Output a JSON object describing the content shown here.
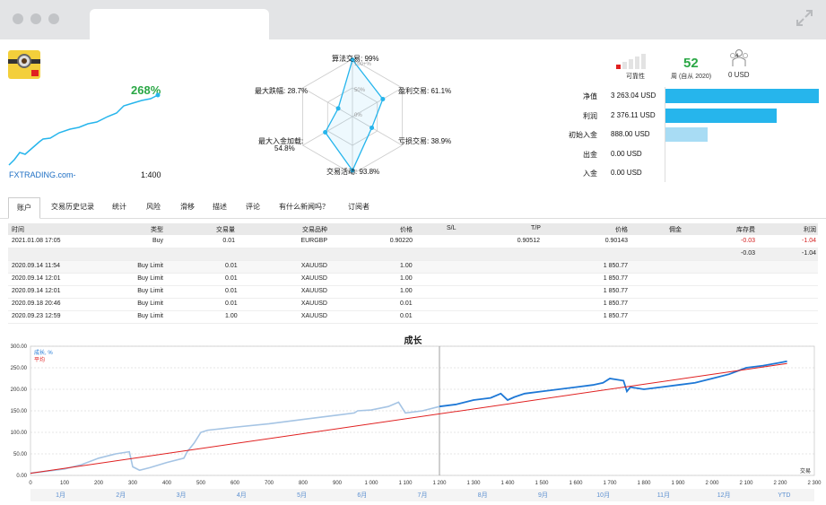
{
  "header": {
    "growth": "268%",
    "broker": "FXTRADING.com-",
    "leverage": "1:400"
  },
  "radar": {
    "algo": "算法交易: 99%",
    "scale100": "100+%",
    "scale50": "50%",
    "scale0": "0%",
    "profit_trades": "盈利交易: 61.1%",
    "loss_trades": "亏损交易: 38.9%",
    "activity": "交易活动: 93.8%",
    "max_deposit_load1": "最大入金加载:",
    "max_deposit_load2": "54.8%",
    "max_drawdown": "最大跌幅: 28.7%",
    "values": [
      99,
      61.1,
      38.9,
      93.8,
      54.8,
      28.7
    ]
  },
  "stats": {
    "reliability_label": "可靠性",
    "weeks_value": "52",
    "weeks_label": "周 (自从 2020)",
    "subscribers_value": "0 USD",
    "subscribers_count": "4"
  },
  "finance": [
    {
      "label": "净值",
      "value": "3 263.04 USD",
      "fraction": 1.0,
      "color": "#26b5ec"
    },
    {
      "label": "利润",
      "value": "2 376.11 USD",
      "fraction": 0.728,
      "color": "#26b5ec"
    },
    {
      "label": "初始入金",
      "value": "888.00 USD",
      "fraction": 0.272,
      "color": "#a8dcf4"
    },
    {
      "label": "出金",
      "value": "0.00 USD",
      "fraction": 0,
      "color": "#26b5ec"
    },
    {
      "label": "入金",
      "value": "0.00 USD",
      "fraction": 0,
      "color": "#26b5ec"
    }
  ],
  "tabs": [
    "账户",
    "交易历史记录",
    "统计",
    "风险",
    "滑移",
    "描述",
    "评论",
    "有什么新闻吗？",
    "订阅者"
  ],
  "table": {
    "headers": [
      "时间",
      "类型",
      "交易量",
      "交易品种",
      "价格",
      "S/L",
      "T/P",
      "价格",
      "佣金",
      "库存费",
      "利润"
    ],
    "open_row": [
      "2021.01.08 17:05",
      "Buy",
      "0.01",
      "EURGBP",
      "0.90220",
      "",
      "0.90512",
      "0.90143",
      "",
      "-0.03",
      "-1.04"
    ],
    "total_row": {
      "swap": "-0.03",
      "profit": "-1.04"
    },
    "orders": [
      [
        "2020.09.14 11:54",
        "Buy Limit",
        "0.01",
        "XAUUSD",
        "1.00",
        "1 850.77"
      ],
      [
        "2020.09.14 12:01",
        "Buy Limit",
        "0.01",
        "XAUUSD",
        "1.00",
        "1 850.77"
      ],
      [
        "2020.09.14 12:01",
        "Buy Limit",
        "0.01",
        "XAUUSD",
        "1.00",
        "1 850.77"
      ],
      [
        "2020.09.18 20:46",
        "Buy Limit",
        "0.01",
        "XAUUSD",
        "0.01",
        "1 850.77"
      ],
      [
        "2020.09.23 12:59",
        "Buy Limit",
        "1.00",
        "XAUUSD",
        "0.01",
        "1 850.77"
      ]
    ]
  },
  "chart_data": {
    "type": "line",
    "title": "成长",
    "legend": [
      "成长, %",
      "平均"
    ],
    "xlabel": "交易",
    "xlim": [
      0,
      2300
    ],
    "ylim": [
      0,
      300
    ],
    "yticks": [
      "0.00",
      "50.00",
      "100.00",
      "150.00",
      "200.00",
      "250.00",
      "300.00"
    ],
    "xticks": [
      "0",
      "100",
      "200",
      "300",
      "400",
      "500",
      "600",
      "700",
      "800",
      "900",
      "1 000",
      "1 100",
      "1 200",
      "1 300",
      "1 400",
      "1 500",
      "1 600",
      "1 700",
      "1 800",
      "1 900",
      "2 000",
      "2 100",
      "2 200",
      "2 300"
    ],
    "months": [
      "1月",
      "2月",
      "3月",
      "4月",
      "5月",
      "6月",
      "7月",
      "8月",
      "9月",
      "10月",
      "11月",
      "12月",
      "YTD"
    ],
    "series": [
      {
        "name": "成长, %",
        "x": [
          0,
          50,
          100,
          150,
          200,
          250,
          290,
          300,
          320,
          350,
          400,
          450,
          460,
          480,
          500,
          520,
          600,
          700,
          800,
          900,
          950,
          960,
          1000,
          1050,
          1080,
          1100,
          1150,
          1200,
          1250,
          1300,
          1350,
          1380,
          1400,
          1420,
          1450,
          1500,
          1550,
          1600,
          1650,
          1680,
          1700,
          1740,
          1750,
          1760,
          1800,
          1850,
          1900,
          1950,
          2000,
          2050,
          2100,
          2150,
          2200,
          2220
        ],
        "y": [
          5,
          10,
          15,
          25,
          40,
          50,
          55,
          20,
          12,
          18,
          30,
          40,
          55,
          75,
          100,
          105,
          112,
          120,
          130,
          140,
          145,
          150,
          152,
          160,
          170,
          145,
          150,
          160,
          165,
          175,
          180,
          190,
          175,
          182,
          190,
          195,
          200,
          205,
          210,
          215,
          225,
          220,
          195,
          205,
          200,
          205,
          210,
          215,
          225,
          235,
          250,
          255,
          262,
          265
        ]
      },
      {
        "name": "平均",
        "x": [
          0,
          2220
        ],
        "y": [
          5,
          260
        ]
      }
    ]
  }
}
